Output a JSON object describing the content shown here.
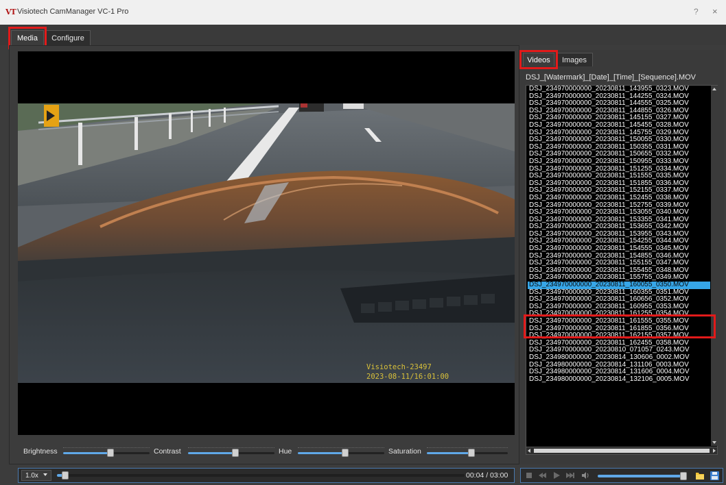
{
  "window": {
    "title": "Visiotech CamManager VC-1 Pro",
    "logo_text": "VT",
    "help_label": "?",
    "close_label": "×"
  },
  "tabs": [
    {
      "label": "Media",
      "active": true,
      "highlighted": true
    },
    {
      "label": "Configure",
      "active": false
    }
  ],
  "media": {
    "video": {
      "watermark_line1": "Visiotech-23497",
      "watermark_line2": "2023-08-11/16:01:00"
    },
    "adjustments": [
      {
        "label": "Brightness",
        "value_percent": 55
      },
      {
        "label": "Contrast",
        "value_percent": 55
      },
      {
        "label": "Hue",
        "value_percent": 55
      },
      {
        "label": "Saturation",
        "value_percent": 55
      }
    ],
    "playback": {
      "speed": "1.0x",
      "position_percent": 2,
      "timecode": "00:04 / 03:00"
    }
  },
  "side": {
    "subtabs": [
      {
        "label": "Videos",
        "active": true,
        "highlighted": true
      },
      {
        "label": "Images",
        "active": false
      }
    ],
    "filename_pattern": "DSJ_[Watermark]_[Date]_[Time]_[Sequence].MOV",
    "files": [
      "DSJ_234970000000_20230811_143955_0323.MOV",
      "DSJ_234970000000_20230811_144255_0324.MOV",
      "DSJ_234970000000_20230811_144555_0325.MOV",
      "DSJ_234970000000_20230811_144855_0326.MOV",
      "DSJ_234970000000_20230811_145155_0327.MOV",
      "DSJ_234970000000_20230811_145455_0328.MOV",
      "DSJ_234970000000_20230811_145755_0329.MOV",
      "DSJ_234970000000_20230811_150055_0330.MOV",
      "DSJ_234970000000_20230811_150355_0331.MOV",
      "DSJ_234970000000_20230811_150655_0332.MOV",
      "DSJ_234970000000_20230811_150955_0333.MOV",
      "DSJ_234970000000_20230811_151255_0334.MOV",
      "DSJ_234970000000_20230811_151555_0335.MOV",
      "DSJ_234970000000_20230811_151855_0336.MOV",
      "DSJ_234970000000_20230811_152155_0337.MOV",
      "DSJ_234970000000_20230811_152455_0338.MOV",
      "DSJ_234970000000_20230811_152755_0339.MOV",
      "DSJ_234970000000_20230811_153055_0340.MOV",
      "DSJ_234970000000_20230811_153355_0341.MOV",
      "DSJ_234970000000_20230811_153655_0342.MOV",
      "DSJ_234970000000_20230811_153955_0343.MOV",
      "DSJ_234970000000_20230811_154255_0344.MOV",
      "DSJ_234970000000_20230811_154555_0345.MOV",
      "DSJ_234970000000_20230811_154855_0346.MOV",
      "DSJ_234970000000_20230811_155155_0347.MOV",
      "DSJ_234970000000_20230811_155455_0348.MOV",
      "DSJ_234970000000_20230811_155755_0349.MOV",
      "DSJ_234970000000_20230811_160055_0350.MOV",
      "DSJ_234970000000_20230811_160355_0351.MOV",
      "DSJ_234970000000_20230811_160656_0352.MOV",
      "DSJ_234970000000_20230811_160955_0353.MOV",
      "DSJ_234970000000_20230811_161255_0354.MOV",
      "DSJ_234970000000_20230811_161555_0355.MOV",
      "DSJ_234970000000_20230811_161855_0356.MOV",
      "DSJ_234970000000_20230811_162155_0357.MOV",
      "DSJ_234970000000_20230811_162455_0358.MOV",
      "DSJ_234970000000_20230810_071057_0243.MOV",
      "DSJ_234980000000_20230814_130606_0002.MOV",
      "DSJ_234980000000_20230814_131106_0003.MOV",
      "DSJ_234980000000_20230814_131606_0004.MOV",
      "DSJ_234980000000_20230814_132106_0005.MOV"
    ],
    "selected_index": 27,
    "volume_percent": 100
  },
  "colors": {
    "highlight_box": "#e21a1a",
    "selection": "#36a6e8",
    "slider_fill": "#5fa8e8",
    "watermark": "#d8c03a"
  },
  "icons": [
    "stop-icon",
    "previous-icon",
    "play-icon",
    "next-icon",
    "volume-icon",
    "folder-icon",
    "save-icon",
    "dropdown-caret-icon"
  ]
}
